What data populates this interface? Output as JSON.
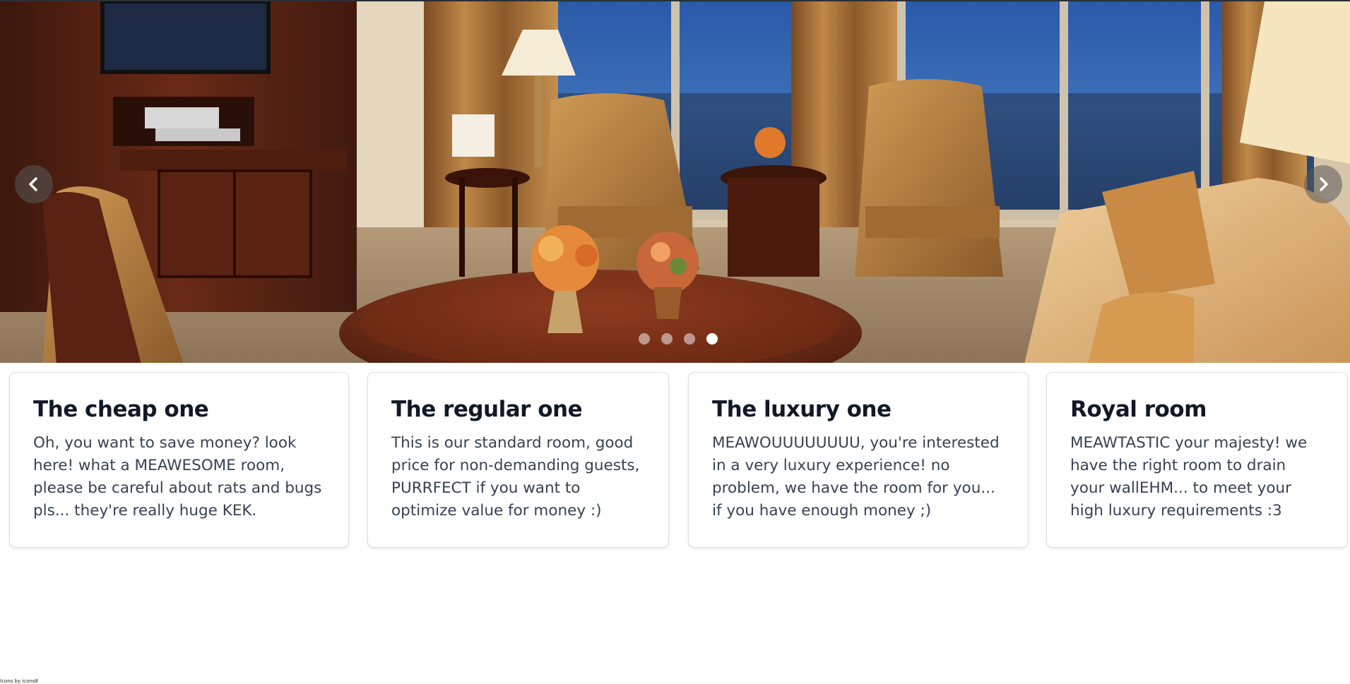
{
  "carousel": {
    "prev_icon": "chevron-left-icon",
    "next_icon": "chevron-right-icon",
    "slide_count": 4,
    "active_index": 3
  },
  "rooms": [
    {
      "title": "The cheap one",
      "description": "Oh, you want to save money? look here! what a MEAWESOME room, please be careful about rats and bugs pls... they're really huge KEK."
    },
    {
      "title": "The regular one",
      "description": "This is our standard room, good price for non-demanding guests, PURRFECT if you want to optimize value for money :)"
    },
    {
      "title": "The luxury one",
      "description": "MEAWOUUUUUUUU, you're interested in a very luxury experience! no problem, we have the room for you... if you have enough money ;)"
    },
    {
      "title": "Royal room",
      "description": "MEAWTASTIC your majesty! we have the right room to drain your wallEHM... to meet your high luxury requirements :3"
    }
  ],
  "footer": {
    "credit": "Icons by icons8"
  }
}
